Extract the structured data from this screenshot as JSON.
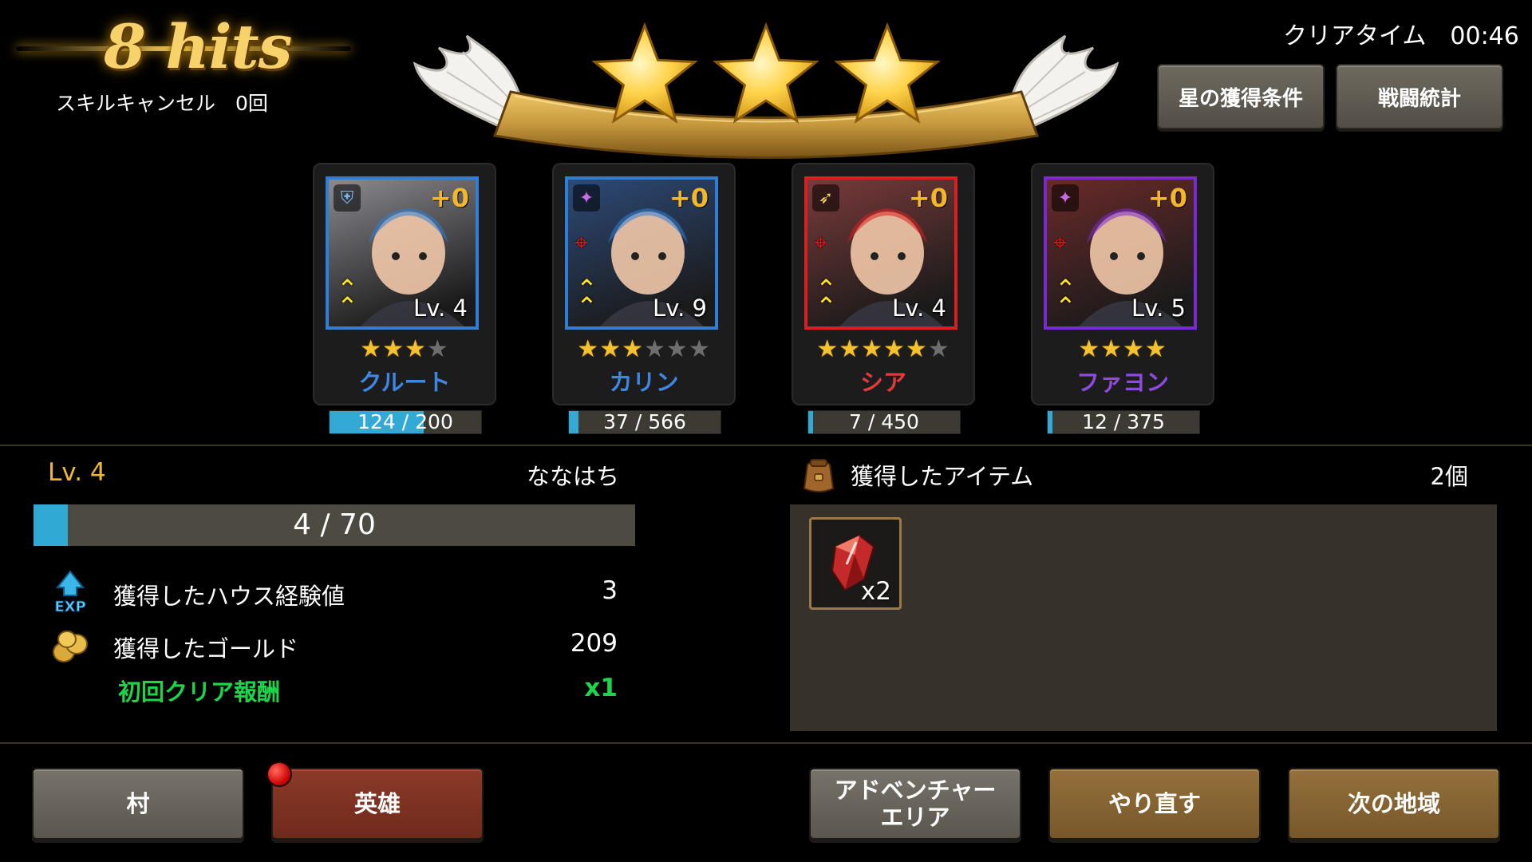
{
  "header": {
    "hits": "8 hits",
    "skill_cancel": "スキルキャンセル　0回",
    "clear_time": "クリアタイム　00:46",
    "star_condition_button": "星の獲得条件",
    "battle_stats_button": "戦闘統計",
    "earned_stars": 3,
    "max_stars": 3
  },
  "heroes": [
    {
      "name": "クルート",
      "plus": "+0",
      "level": "Lv. 4",
      "stars_on": 3,
      "stars_total": 4,
      "xp_text": "124 / 200",
      "xp_fraction": 0.62,
      "frame_color": "#2f7fd6",
      "name_color": "#3d86e3",
      "role_icon": "shield-icon",
      "bg": "#8a8a90"
    },
    {
      "name": "カリン",
      "plus": "+0",
      "level": "Lv. 9",
      "stars_on": 3,
      "stars_total": 6,
      "xp_text": "37 / 566",
      "xp_fraction": 0.065,
      "frame_color": "#2f7fd6",
      "name_color": "#3d86e3",
      "role_icon": "magic-icon",
      "bg": "#2d4a78"
    },
    {
      "name": "シア",
      "plus": "+0",
      "level": "Lv. 4",
      "stars_on": 5,
      "stars_total": 6,
      "xp_text": "7 / 450",
      "xp_fraction": 0.016,
      "frame_color": "#d92020",
      "name_color": "#e23a3a",
      "role_icon": "bow-icon",
      "bg": "#7a3a3a"
    },
    {
      "name": "ファヨン",
      "plus": "+0",
      "level": "Lv. 5",
      "stars_on": 4,
      "stars_total": 4,
      "xp_text": "12 / 375",
      "xp_fraction": 0.032,
      "frame_color": "#7a2bd0",
      "name_color": "#8e4ae0",
      "role_icon": "magic-icon",
      "bg": "#6a2a2a"
    }
  ],
  "player": {
    "level": "Lv. 4",
    "name": "ななはち",
    "xp_text": "4 / 70",
    "xp_fraction": 0.057
  },
  "rewards": {
    "house_exp_label": "獲得したハウス経験値",
    "house_exp_value": "3",
    "gold_label": "獲得したゴールド",
    "gold_value": "209",
    "first_clear_label": "初回クリア報酬",
    "first_clear_value": "x1",
    "exp_icon_text": "EXP"
  },
  "items": {
    "label": "獲得したアイテム",
    "count": "2個",
    "list": [
      {
        "icon": "red-crystal-icon",
        "qty": "x2"
      }
    ]
  },
  "bottom_buttons": {
    "village": "村",
    "heroes": "英雄",
    "adventure_area": "アドベンチャー\nエリア",
    "retry": "やり直す",
    "next_region": "次の地域"
  },
  "colors": {
    "gold_text": "#f1b92e",
    "first_clear_green": "#1bd64a",
    "xp_blue": "#30a9d4"
  }
}
